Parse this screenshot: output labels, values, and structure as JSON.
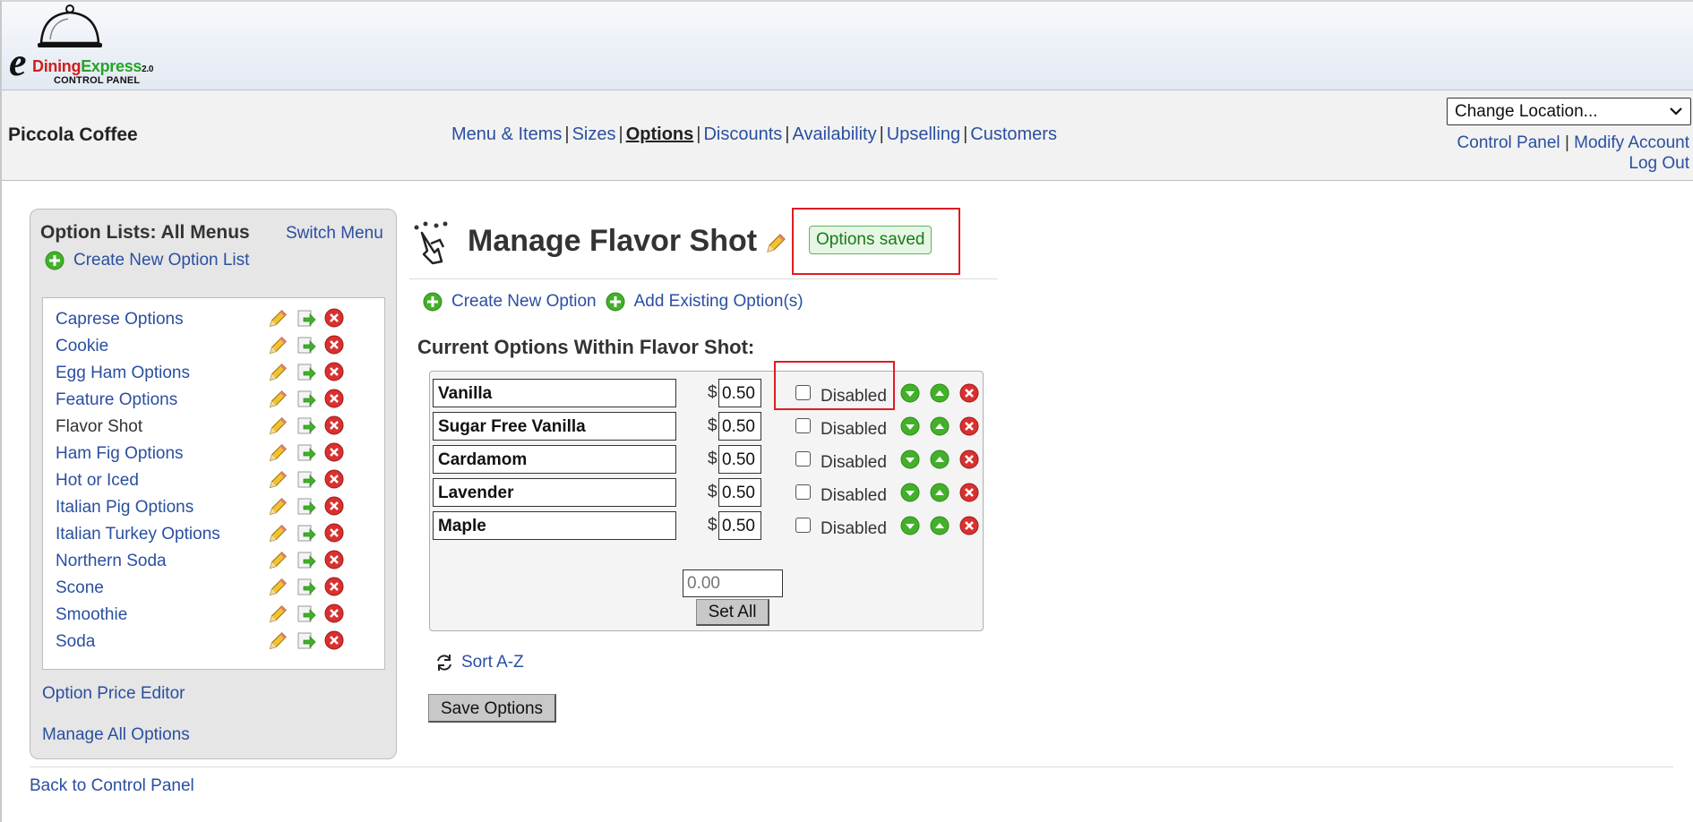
{
  "header": {
    "logo_e": "e",
    "logo_word1": "Dining",
    "logo_word2": "Express",
    "logo_version": "2.0",
    "logo_sub": "CONTROL PANEL"
  },
  "topbar": {
    "business_name": "Piccola Coffee",
    "nav": [
      "Menu & Items",
      "Sizes",
      "Options",
      "Discounts",
      "Availability",
      "Upselling",
      "Customers"
    ],
    "nav_separator": "|",
    "active_nav": "Options",
    "location_select": "Change Location...",
    "account_links": [
      "Control Panel",
      "Modify Account",
      "Log Out"
    ]
  },
  "sidebar": {
    "title": "Option Lists: All Menus",
    "switch_menu": "Switch Menu",
    "create_list": "Create New Option List",
    "lists": [
      "Caprese Options",
      "Cookie",
      "Egg Ham Options",
      "Feature Options",
      "Flavor Shot",
      "Ham Fig Options",
      "Hot or Iced",
      "Italian Pig Options",
      "Italian Turkey Options",
      "Northern Soda",
      "Scone",
      "Smoothie",
      "Soda"
    ],
    "current_list": "Flavor Shot",
    "price_editor": "Option Price Editor",
    "manage_all": "Manage All Options"
  },
  "main": {
    "title": "Manage Flavor Shot",
    "saved_message": "Options saved",
    "create_option": "Create New Option",
    "add_existing": "Add Existing Option(s)",
    "section_title": "Current Options Within Flavor Shot:",
    "currency": "$",
    "disabled_label": "Disabled",
    "options": [
      {
        "name": "Vanilla",
        "price": "0.50",
        "disabled": false
      },
      {
        "name": "Sugar Free Vanilla",
        "price": "0.50",
        "disabled": false
      },
      {
        "name": "Cardamom",
        "price": "0.50",
        "disabled": false
      },
      {
        "name": "Lavender",
        "price": "0.50",
        "disabled": false
      },
      {
        "name": "Maple",
        "price": "0.50",
        "disabled": false
      }
    ],
    "set_all_placeholder": "0.00",
    "set_all_button": "Set All",
    "sort_link": "Sort A-Z",
    "save_button": "Save Options"
  },
  "footer": {
    "back_link": "Back to Control Panel"
  },
  "colors": {
    "link": "#2a4fa0",
    "highlight": "#e01b24",
    "saved_text": "#1a7a1a",
    "add_icon": "#43b02a",
    "delete_icon": "#d93030"
  }
}
